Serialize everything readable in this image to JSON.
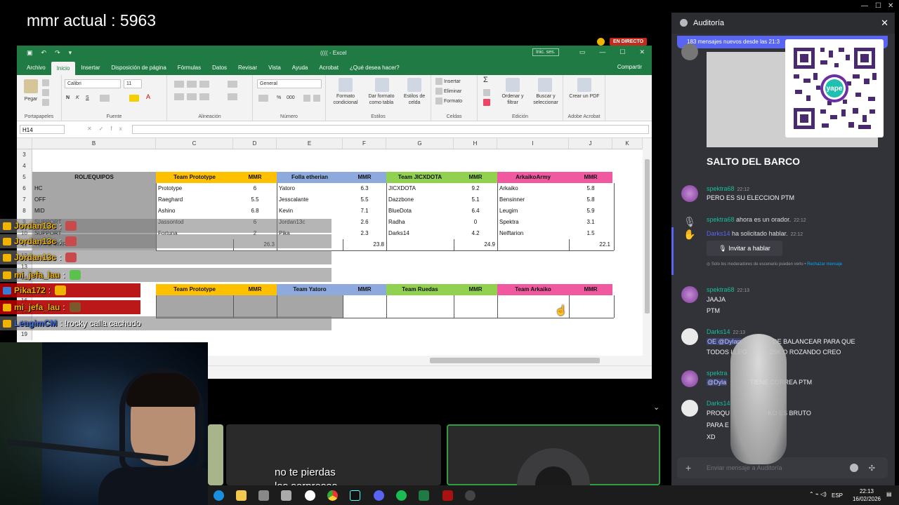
{
  "overlay": {
    "mmr_label": "mmr actual : 5963"
  },
  "excel": {
    "window_title": "((((  -  Excel",
    "signin": "Inic. ses.",
    "tabs": [
      "Archivo",
      "Inicio",
      "Insertar",
      "Disposición de página",
      "Fórmulas",
      "Datos",
      "Revisar",
      "Vista",
      "Ayuda",
      "Acrobat",
      "¿Qué desea hacer?"
    ],
    "share": "Compartir",
    "ribbon": {
      "paste": "Pegar",
      "font_name": "Calibri",
      "font_size": "11",
      "number_format": "General",
      "conditional": "Formato condicional",
      "as_table": "Dar formato como tabla",
      "cell_styles": "Estilos de celda",
      "insert": "Insertar",
      "delete": "Eliminar",
      "format": "Formato",
      "sort": "Ordenar y filtrar",
      "find": "Buscar y seleccionar",
      "pdf": "Crear un PDF",
      "groups": [
        "Portapapeles",
        "Fuente",
        "Alineación",
        "Número",
        "Estilos",
        "Celdas",
        "Edición",
        "Adobe Acrobat"
      ]
    },
    "name_box": "H14",
    "columns": [
      "B",
      "C",
      "D",
      "E",
      "F",
      "G",
      "H",
      "I",
      "J",
      "K"
    ],
    "rows": [
      "3",
      "4",
      "5",
      "6",
      "7",
      "8",
      "9",
      "10",
      "11",
      "12",
      "13",
      "14",
      "15",
      "16",
      "17",
      "18",
      "19"
    ],
    "header_row": [
      "ROL/EQUIPOS",
      "Team Prototype",
      "MMR",
      "Folla etherian",
      "MMR",
      "Team JICXDOTA",
      "MMR",
      "ArkaikoArmy",
      "MMR"
    ],
    "data_rows": [
      [
        "HC",
        "Prototype",
        "6",
        "Yatoro",
        "6.3",
        "JICXDOTA",
        "9.2",
        "Arkaiko",
        "5.8"
      ],
      [
        "OFF",
        "Raeghard",
        "5.5",
        "Jesscalante",
        "5.5",
        "Dazzbone",
        "5.1",
        "Bensinner",
        "5.8"
      ],
      [
        "MID",
        "Ashino",
        "6.8",
        "Kevin",
        "7.1",
        "BlueDota",
        "6.4",
        "Leugim",
        "5.9"
      ],
      [
        "SUPPORT",
        "Jassontod",
        "6",
        "Jordan13c",
        "2.6",
        "Radha",
        "0",
        "Spektra",
        "3.1"
      ],
      [
        "SUPPORT",
        "Fortuna",
        "2",
        "Pika",
        "2.3",
        "Darks14",
        "4.2",
        "Nelftarion",
        "1.5"
      ]
    ],
    "totals_label": "TOTAL MMR",
    "totals": [
      "26.3",
      "23.8",
      "24.9",
      "22.1"
    ],
    "header_row2": [
      "Team Prototype",
      "MMR",
      "Team Yatoro",
      "MMR",
      "Team Ruedas",
      "MMR",
      "Team Arkaiko",
      "MMR"
    ]
  },
  "live_badge": "EN DIRECTO",
  "chat": [
    {
      "user": "Jordan13c",
      "msg": ":",
      "color": "#f0b400"
    },
    {
      "user": "Jordan13c",
      "msg": ":",
      "color": "#f0b400"
    },
    {
      "user": "Jordan13c",
      "msg": ":",
      "color": "#f0b400"
    },
    {
      "user": "mi_jefa_lau",
      "msg": ":",
      "color": "#f0b400"
    },
    {
      "user": "Pika172",
      "msg": ":",
      "color": "#f0b400"
    },
    {
      "user": "mi_jefa_lau",
      "msg": ":",
      "color": "#f0b400"
    },
    {
      "user": "LeugimCM",
      "msg": ": !rocky calla cachudo",
      "color": "#3a6de0"
    }
  ],
  "subtitles": {
    "line1": "no te pierdas",
    "line2": "las sorpresas"
  },
  "discord": {
    "title": "Auditoría",
    "new_messages": "183 mensajes nuevos desde las 21:3",
    "stage_title": "SALTO DEL BARCO",
    "qr_label": "yape",
    "messages": [
      {
        "name": "spektra68",
        "time": "22:12",
        "text": "PERO ES SU ELECCION PTM"
      },
      {
        "name": "spektra68",
        "time": "22:12",
        "text": "ahora es un orador."
      },
      {
        "name": "Darks14",
        "time": "22:12",
        "text": "ha solicitado hablar."
      },
      {
        "name": "spektra68",
        "time": "22:13",
        "line1": "JAAJA",
        "line2": "PTM"
      },
      {
        "name": "Darks14",
        "time": "22:13",
        "line1": "OE @Dylan",
        "line1b": "DE BALANCEAR PARA QUE",
        "line2": "TODOS LLEG",
        "line2b": "25K O ROZANDO CREO"
      },
      {
        "name": "spektra",
        "line1": "@Dyla",
        "line1b": "TIENE CORREA PTM"
      },
      {
        "name": "Darks14",
        "line1": "PROQU",
        "line1b": "KO ES BRUTO",
        "line2": "PARA E",
        "line3": "XD"
      }
    ],
    "invite_button": "Invitar a hablar",
    "mod_note": "Solo los moderadores de escenario pueden verlo •",
    "mod_link": "Rechazar mensaje",
    "input_placeholder": "Enviar mensaje a Auditoría"
  },
  "taskbar": {
    "lang": "ESP",
    "time": "22:13",
    "date": "16/02/2026"
  }
}
